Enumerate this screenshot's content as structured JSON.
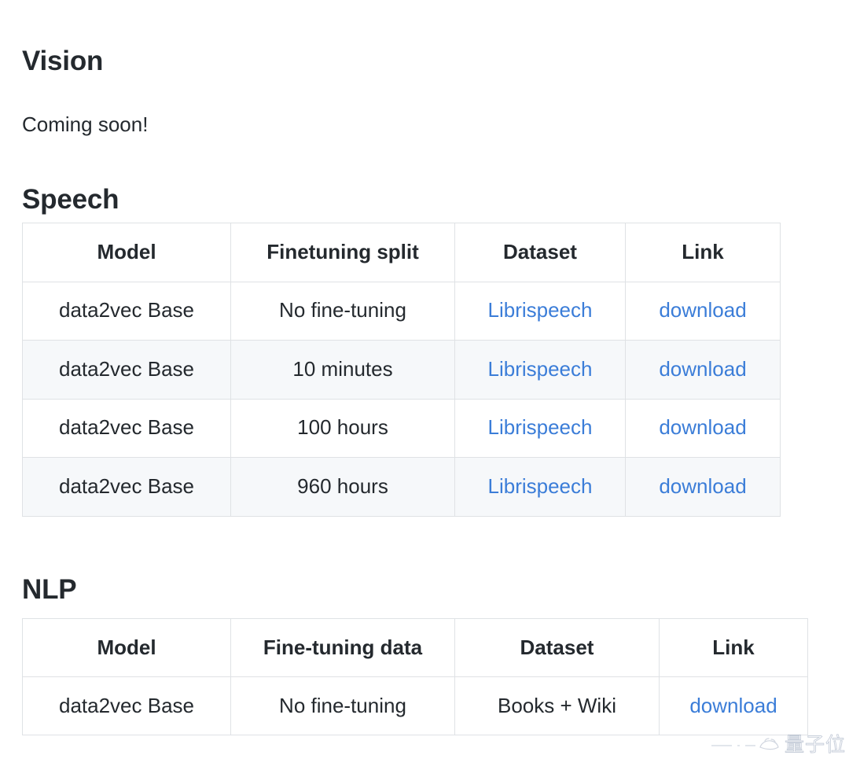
{
  "sections": {
    "vision": {
      "heading": "Vision",
      "body": "Coming soon!"
    },
    "speech": {
      "heading": "Speech",
      "table": {
        "columns": [
          "Model",
          "Finetuning split",
          "Dataset",
          "Link"
        ],
        "rows": [
          {
            "model": "data2vec Base",
            "finetuning": "No fine-tuning",
            "dataset": "Librispeech",
            "link": "download"
          },
          {
            "model": "data2vec Base",
            "finetuning": "10 minutes",
            "dataset": "Librispeech",
            "link": "download"
          },
          {
            "model": "data2vec Base",
            "finetuning": "100 hours",
            "dataset": "Librispeech",
            "link": "download"
          },
          {
            "model": "data2vec Base",
            "finetuning": "960 hours",
            "dataset": "Librispeech",
            "link": "download"
          }
        ]
      }
    },
    "nlp": {
      "heading": "NLP",
      "table": {
        "columns": [
          "Model",
          "Fine-tuning data",
          "Dataset",
          "Link"
        ],
        "rows": [
          {
            "model": "data2vec Base",
            "finetuning": "No fine-tuning",
            "dataset": "Books + Wiki",
            "link": "download"
          }
        ]
      }
    }
  },
  "watermark": {
    "text": "量子位",
    "icon": "qbitai-watermark-icon"
  },
  "colors": {
    "text": "#24292e",
    "link": "#3b7dd8",
    "border": "#dfe2e5",
    "zebra_row": "#f6f8fa",
    "page_background": "#ffffff",
    "watermark": "#9aa7bd"
  }
}
